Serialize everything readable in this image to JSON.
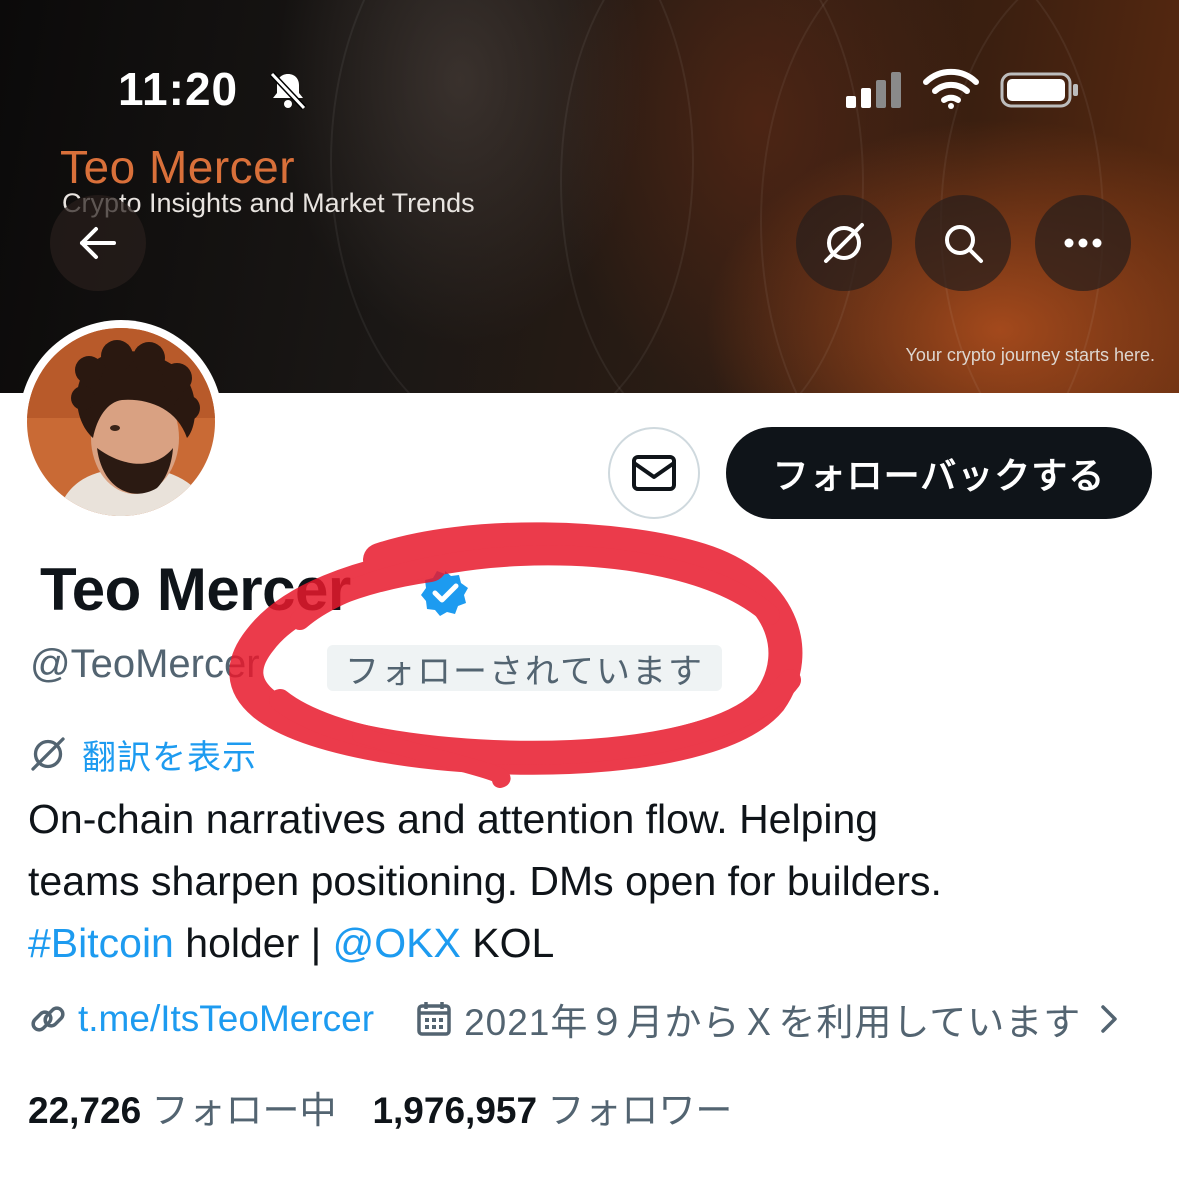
{
  "status_bar": {
    "time": "11:20"
  },
  "banner": {
    "brand_title": "Teo Mercer",
    "brand_subtitle": "Crypto Insights and Market Trends",
    "tagline": "Your crypto journey starts here."
  },
  "icons": {
    "back": "arrow-left-icon",
    "translate": "translate-icon",
    "search": "search-icon",
    "more": "more-icon",
    "message": "envelope-icon",
    "verified": "verified-badge-icon",
    "link": "link-icon",
    "calendar": "calendar-icon"
  },
  "profile": {
    "follow_back_label": "フォローバックする",
    "name": "Teo Mercer",
    "handle": "@TeoMercer",
    "follows_you": "フォローされています",
    "translate_label": "翻訳を表示",
    "bio": {
      "line1": "On-chain narratives and attention flow. Helping",
      "line2": "teams sharpen positioning. DMs open for builders.",
      "hashtag": "#Bitcoin",
      "holder_text": " holder | ",
      "mention": "@OKX",
      "kol_text": " KOL"
    },
    "url": "t.me/ItsTeoMercer",
    "joined": "2021年９月からＸを利用しています",
    "following_count": "22,726",
    "following_label": "フォロー中",
    "followers_count": "1,976,957",
    "followers_label": "フォロワー"
  },
  "colors": {
    "accent": "#1d9bf0",
    "text_primary": "#0f1419",
    "text_secondary": "#536471",
    "annotation": "#e8192c",
    "brand": "#d9703a"
  }
}
